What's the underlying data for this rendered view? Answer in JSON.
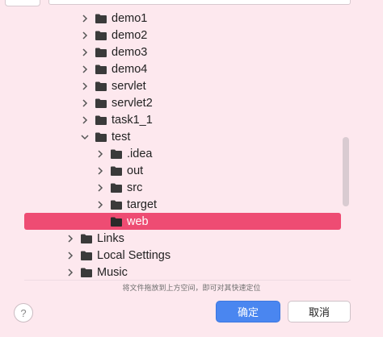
{
  "tree": [
    {
      "label": "demo1",
      "expanded": false,
      "level": 1
    },
    {
      "label": "demo2",
      "expanded": false,
      "level": 1
    },
    {
      "label": "demo3",
      "expanded": false,
      "level": 1
    },
    {
      "label": "demo4",
      "expanded": false,
      "level": 1
    },
    {
      "label": "servlet",
      "expanded": false,
      "level": 1
    },
    {
      "label": "servlet2",
      "expanded": false,
      "level": 1
    },
    {
      "label": "task1_1",
      "expanded": false,
      "level": 1
    },
    {
      "label": "test",
      "expanded": true,
      "level": 1
    },
    {
      "label": ".idea",
      "expanded": false,
      "level": 2
    },
    {
      "label": "out",
      "expanded": false,
      "level": 2
    },
    {
      "label": "src",
      "expanded": false,
      "level": 2
    },
    {
      "label": "target",
      "expanded": false,
      "level": 2
    },
    {
      "label": "web",
      "expanded": false,
      "level": 2,
      "selected": true
    },
    {
      "label": "Links",
      "expanded": false,
      "level": 0
    },
    {
      "label": "Local Settings",
      "expanded": false,
      "level": 0
    },
    {
      "label": "Music",
      "expanded": false,
      "level": 0
    }
  ],
  "footer": {
    "hint": "将文件拖放到上方空间，即可对其快速定位",
    "help_label": "?",
    "ok_label": "确定",
    "cancel_label": "取消"
  },
  "colors": {
    "background": "#fde8ee",
    "selection": "#ee4c73",
    "primary_button": "#4a86f0"
  }
}
